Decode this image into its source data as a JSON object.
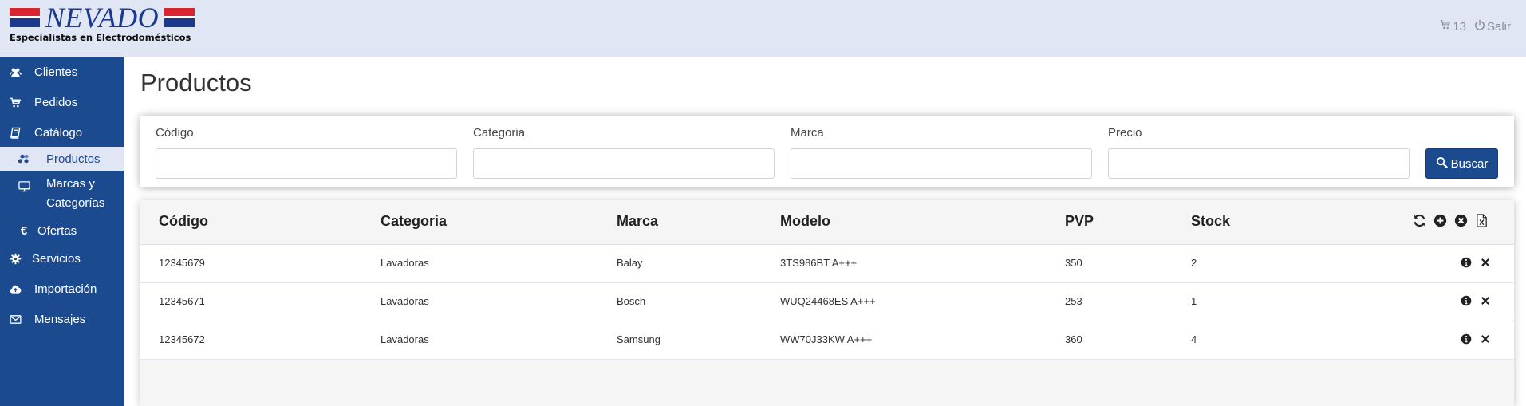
{
  "header": {
    "logo_name": "NEVADO",
    "logo_tagline": "Especialistas en Electrodomésticos",
    "cart_count": "13",
    "logout_label": "Salir",
    "colors": {
      "bar": "#e1e6f5",
      "brand_blue": "#1c3a8d",
      "brand_red": "#d8252f"
    }
  },
  "sidebar": {
    "items": [
      {
        "label": "Clientes",
        "icon": "users-icon"
      },
      {
        "label": "Pedidos",
        "icon": "cart-icon"
      },
      {
        "label": "Catálogo",
        "icon": "book-icon"
      },
      {
        "label": "Productos",
        "icon": "cubes-icon",
        "active": true
      },
      {
        "label_line1": "Marcas y",
        "label_line2": "Categorías",
        "icon": "monitor-icon"
      },
      {
        "label": "Ofertas",
        "icon": "euro-icon"
      },
      {
        "label": "Servicios",
        "icon": "gear-icon"
      },
      {
        "label": "Importación",
        "icon": "cloud-upload-icon"
      },
      {
        "label": "Mensajes",
        "icon": "envelope-icon"
      }
    ]
  },
  "page": {
    "title": "Productos"
  },
  "filters": {
    "codigo": {
      "label": "Código",
      "value": ""
    },
    "categoria": {
      "label": "Categoria",
      "value": ""
    },
    "marca": {
      "label": "Marca",
      "value": ""
    },
    "precio": {
      "label": "Precio",
      "value": ""
    },
    "search_label": "Buscar"
  },
  "table": {
    "columns": [
      "Código",
      "Categoria",
      "Marca",
      "Modelo",
      "PVP",
      "Stock"
    ],
    "toolbar_icons": [
      "refresh-icon",
      "plus-circle-icon",
      "times-circle-icon",
      "excel-icon"
    ],
    "rows": [
      {
        "codigo": "12345679",
        "categoria": "Lavadoras",
        "marca": "Balay",
        "modelo": "3TS986BT A+++",
        "pvp": "350",
        "stock": "2"
      },
      {
        "codigo": "12345671",
        "categoria": "Lavadoras",
        "marca": "Bosch",
        "modelo": "WUQ24468ES A+++",
        "pvp": "253",
        "stock": "1"
      },
      {
        "codigo": "12345672",
        "categoria": "Lavadoras",
        "marca": "Samsung",
        "modelo": "WW70J33KW A+++",
        "pvp": "360",
        "stock": "4"
      }
    ]
  }
}
